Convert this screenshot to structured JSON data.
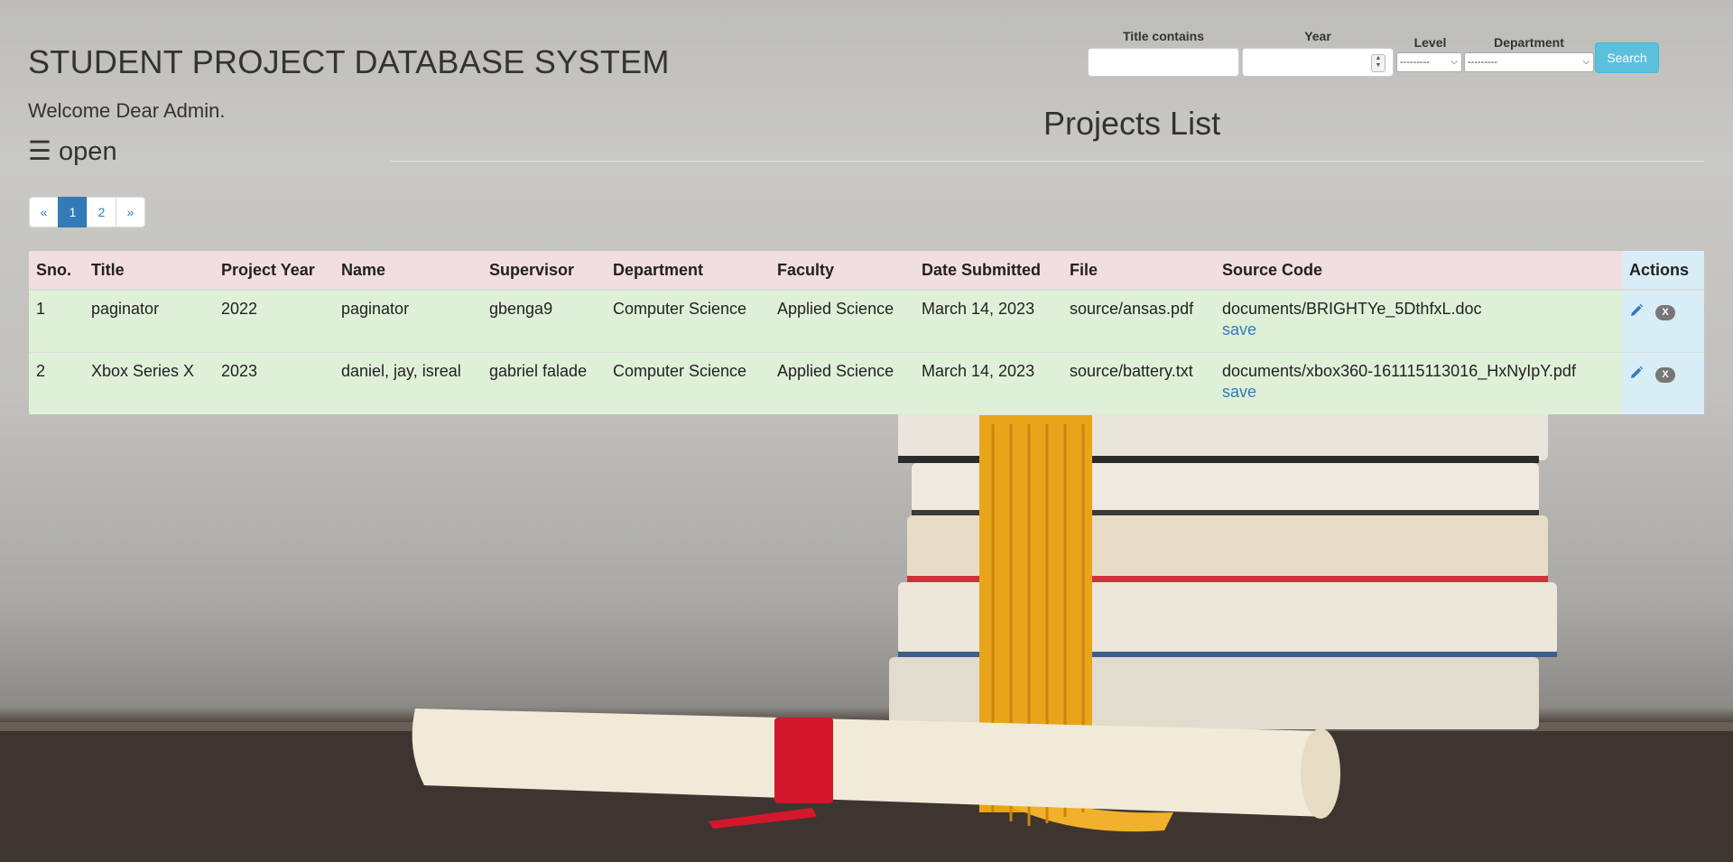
{
  "header": {
    "site_title": "STUDENT PROJECT DATABASE SYSTEM",
    "welcome": "Welcome Dear Admin.",
    "menu_toggle": "☰ open"
  },
  "search": {
    "title_label": "Title contains",
    "title_value": "",
    "year_label": "Year",
    "year_value": "",
    "level_label": "Level",
    "level_selected": "---------",
    "department_label": "Department",
    "department_selected": "---------",
    "button_label": "Search"
  },
  "main": {
    "heading": "Projects List"
  },
  "pagination": {
    "prev": "«",
    "pages": [
      "1",
      "2"
    ],
    "current": "1",
    "next": "»"
  },
  "table": {
    "columns": [
      "Sno.",
      "Title",
      "Project Year",
      "Name",
      "Supervisor",
      "Department",
      "Faculty",
      "Date Submitted",
      "File",
      "Source Code",
      "Actions"
    ],
    "rows": [
      {
        "sno": "1",
        "title": "paginator",
        "year": "2022",
        "name": "paginator",
        "supervisor": "gbenga9",
        "department": "Computer Science",
        "faculty": "Applied Science",
        "date": "March 14, 2023",
        "file": "source/ansas.pdf",
        "source": "documents/BRIGHTYe_5DthfxL.doc",
        "save": "save",
        "delete": "X"
      },
      {
        "sno": "2",
        "title": "Xbox Series X",
        "year": "2023",
        "name": "daniel, jay, isreal",
        "supervisor": "gabriel falade",
        "department": "Computer Science",
        "faculty": "Applied Science",
        "date": "March 14, 2023",
        "file": "source/battery.txt",
        "source": "documents/xbox360-161115113016_HxNyIpY.pdf",
        "save": "save",
        "delete": "X"
      }
    ]
  },
  "icons": {
    "edit": "pencil-icon",
    "delete": "close-badge-icon",
    "year_spinner": "spinner-icon"
  },
  "colors": {
    "header_row": "#f2dede",
    "data_row": "#dff0d8",
    "actions_column": "#d9edf7",
    "link": "#337ab7",
    "search_button": "#5bc0de",
    "pagination_active": "#337ab7"
  }
}
